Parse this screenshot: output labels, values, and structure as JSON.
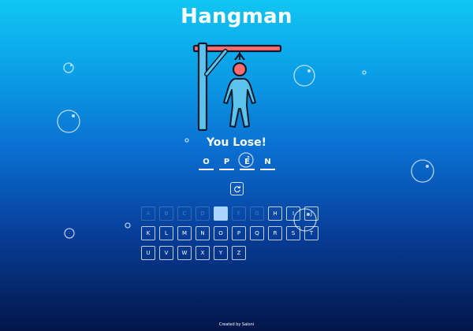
{
  "game": {
    "title": "Hangman",
    "status": "You Lose!",
    "word": [
      "O",
      "P",
      "E",
      "N"
    ]
  },
  "keyboard": {
    "rows": [
      [
        {
          "letter": "A",
          "state": "used"
        },
        {
          "letter": "B",
          "state": "used"
        },
        {
          "letter": "C",
          "state": "used"
        },
        {
          "letter": "D",
          "state": "used"
        },
        {
          "letter": "E",
          "state": "active"
        },
        {
          "letter": "F",
          "state": "used"
        },
        {
          "letter": "G",
          "state": "used"
        },
        {
          "letter": "H",
          "state": "available"
        },
        {
          "letter": "I",
          "state": "available"
        },
        {
          "letter": "J",
          "state": "available"
        }
      ],
      [
        {
          "letter": "K",
          "state": "available"
        },
        {
          "letter": "L",
          "state": "available"
        },
        {
          "letter": "M",
          "state": "available"
        },
        {
          "letter": "N",
          "state": "available"
        },
        {
          "letter": "O",
          "state": "available"
        },
        {
          "letter": "P",
          "state": "available"
        },
        {
          "letter": "Q",
          "state": "available"
        },
        {
          "letter": "R",
          "state": "available"
        },
        {
          "letter": "S",
          "state": "available"
        },
        {
          "letter": "T",
          "state": "available"
        }
      ],
      [
        {
          "letter": "U",
          "state": "available"
        },
        {
          "letter": "V",
          "state": "available"
        },
        {
          "letter": "W",
          "state": "available"
        },
        {
          "letter": "X",
          "state": "available"
        },
        {
          "letter": "Y",
          "state": "available"
        },
        {
          "letter": "Z",
          "state": "available"
        }
      ]
    ]
  },
  "controls": {
    "reset_icon": "restart-icon"
  },
  "footer": {
    "credit": "Created by Saloni"
  },
  "colors": {
    "gallows": "#5bc4ee",
    "beam_accent": "#ff6b6b",
    "head": "#ff6b6b",
    "body": "#5bc4ee",
    "outline": "#0b1a2c"
  }
}
